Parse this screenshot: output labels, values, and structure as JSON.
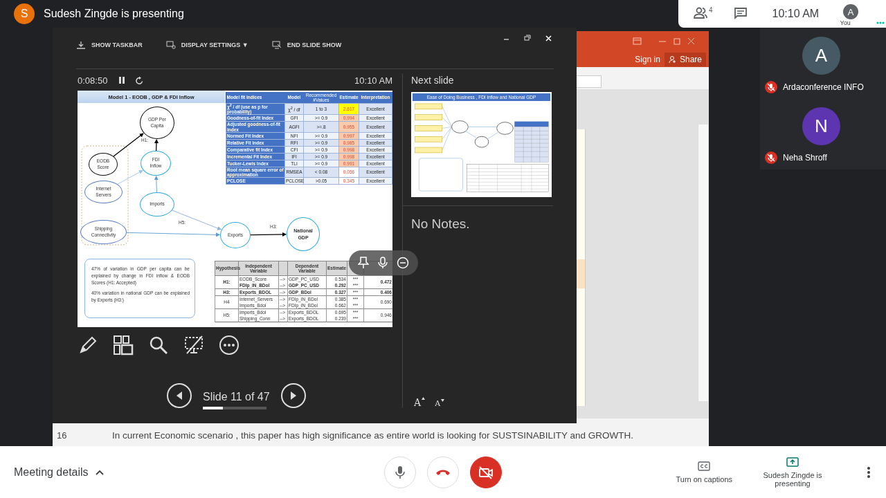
{
  "header": {
    "presenter_initial": "S",
    "title": "Sudesh Zingde is presenting",
    "people_count": "4",
    "time": "10:10 AM",
    "self_initial": "A",
    "self_label": "You"
  },
  "powerpoint": {
    "sign_in": "Sign in",
    "share": "Share",
    "notes_slide_number": "16",
    "notes_text": "In current Economic scenario , this paper has high significance as entire world is looking for SUSTSINABILITY and GROWTH."
  },
  "presenter": {
    "toolbar": [
      {
        "kind": "taskbar",
        "label": "SHOW TASKBAR"
      },
      {
        "kind": "display",
        "label": "DISPLAY SETTINGS ▼"
      },
      {
        "kind": "end",
        "label": "END SLIDE SHOW"
      }
    ],
    "timer": "0:08:50",
    "clock": "10:10 AM",
    "next_slide_label": "Next slide",
    "next_slide_title": "Ease of Doing Business , FDI inflow and National GDP",
    "notes": "No Notes.",
    "font_buttons": [
      {
        "kind": "grow",
        "label": "A"
      },
      {
        "kind": "shrink",
        "label": "A"
      }
    ],
    "slide_counter": "Slide 11 of 47",
    "progress": {
      "level": 0.32
    }
  },
  "slide": {
    "title": "Model 1 - EODB , GDP & FDI Inflow",
    "nodes": [
      {
        "label": "GDP Per Capita",
        "kind": "outcome"
      },
      {
        "label": "EODB Score",
        "kind": "outcome"
      },
      {
        "label": "FDI Inflow",
        "kind": "mediator"
      },
      {
        "label": "Internet Servers",
        "kind": "input"
      },
      {
        "label": "Imports",
        "kind": "mediator"
      },
      {
        "label": "Shipping Connectivity",
        "kind": "input"
      },
      {
        "label": "Exports",
        "kind": "mediator"
      },
      {
        "label": "National GDP",
        "kind": "final"
      }
    ],
    "path_labels": [
      "H1:",
      "H5:",
      "H3:"
    ],
    "callout": [
      "47% of variation in GDP per capita can be explained by change in FDI inflow & EODB Scores (H1: Accepted)",
      "40% variation in national GDP can be explained by Exports (H3:)"
    ],
    "fit_table": {
      "columns": [
        "Model fit indices",
        "Model",
        "Recommended #Values",
        "Estimate",
        "Interpretation"
      ],
      "rows": [
        {
          "index": "χ$^{2}$ / df (use as p for probability)",
          "model": "χ$^{2}$ / df",
          "recommended": "1 to 3",
          "estimate": "2.617",
          "color": "#ffff00",
          "interpretation": "Excellent"
        },
        {
          "index": "Goodness-of-fit Index",
          "model": "GFI",
          "recommended": ">= 0.9",
          "estimate": "0.994",
          "color": "#f8cbad",
          "interpretation": "Excellent"
        },
        {
          "index": "Adjusted goodness-of-fit index",
          "model": "AGFI",
          "recommended": ">=.8",
          "estimate": "0.955",
          "color": "#f8cbad",
          "interpretation": "Excellent"
        },
        {
          "index": "Normed Fit Index",
          "model": "NFI",
          "recommended": ">= 0.9",
          "estimate": "0.997",
          "color": "#f8cbad",
          "interpretation": "Excellent"
        },
        {
          "index": "Relative Fit Index",
          "model": "RFI",
          "recommended": ">= 0.9",
          "estimate": "0.985",
          "color": "#f8cbad",
          "interpretation": "Excellent"
        },
        {
          "index": "Comparative fit Index",
          "model": "CFI",
          "recommended": ">= 0.9",
          "estimate": "0.998",
          "color": "#f8cbad",
          "interpretation": "Excellent"
        },
        {
          "index": "Incremental Fit Index",
          "model": "IFI",
          "recommended": ">= 0.9",
          "estimate": "0.998",
          "color": "#f8cbad",
          "interpretation": "Excellent"
        },
        {
          "index": "Tucker-Lewis Index",
          "model": "TLI",
          "recommended": ">= 0.9",
          "estimate": "0.991",
          "color": "#f8cbad",
          "interpretation": "Excellent"
        },
        {
          "index": "Root mean square error of approximation",
          "model": "RMSEA",
          "recommended": "< 0.08",
          "estimate": "0.056",
          "color": "#ffffff",
          "interpretation": "Excellent"
        },
        {
          "index": "PCLOSE",
          "model": "PCLOSE",
          "recommended": ">0.05",
          "estimate": "0.345",
          "color": "#ffffff",
          "interpretation": "Excellent"
        }
      ]
    },
    "hypothesis_table": {
      "columns": [
        "Hypothesis",
        "Independent Variable",
        "Dependent Variable",
        "Estimate"
      ],
      "groups": [
        {
          "hypothesis": "H1:",
          "r_square": "0.472",
          "bold": true,
          "rows": [
            {
              "independent": "EODB_Score",
              "arrow": "-->",
              "dependent": "GDP_PC_USD",
              "estimate": "0.534",
              "p": "***",
              "bold": false
            },
            {
              "independent": "FDIp_IN_BDol",
              "arrow": "-->",
              "dependent": "GDP_PC_USD",
              "estimate": "0.292",
              "p": "***",
              "bold": true
            }
          ]
        },
        {
          "hypothesis": "H3:",
          "r_square": "0.406",
          "bold": true,
          "rows": [
            {
              "independent": "Exports_BDOL",
              "arrow": "-->",
              "dependent": "GDP_BDol",
              "estimate": "0.327",
              "p": "***",
              "bold": true
            }
          ]
        },
        {
          "hypothesis": "H4",
          "r_square": "0.690",
          "bold": false,
          "rows": [
            {
              "independent": "Internet_Servers",
              "arrow": "-->",
              "dependent": "FDIp_IN_BDol",
              "estimate": "0.385",
              "p": "***",
              "bold": false
            },
            {
              "independent": "Imports_Bdol",
              "arrow": "-->",
              "dependent": "FDIp_IN_BDol",
              "estimate": "0.662",
              "p": "***",
              "bold": false
            }
          ]
        },
        {
          "hypothesis": "H5:",
          "r_square": "0.946",
          "bold": false,
          "rows": [
            {
              "independent": "Imports_Bdol",
              "arrow": "-->",
              "dependent": "Exports_BDOL",
              "estimate": "0.695",
              "p": "***",
              "bold": false
            },
            {
              "independent": "Shipping_Conn",
              "arrow": "-->",
              "dependent": "Exports_BDOL",
              "estimate": "0.239",
              "p": "***",
              "bold": false
            }
          ]
        }
      ]
    }
  },
  "participants": [
    {
      "initial": "A",
      "name": "Ardaconference INFO",
      "color": "#455a64",
      "muted": true
    },
    {
      "initial": "N",
      "name": "Neha Shroff",
      "color": "#5e35b1",
      "muted": true
    }
  ],
  "controls": {
    "meeting_details": "Meeting details",
    "mic_on": true,
    "camera_on": false,
    "captions": "Turn on captions",
    "presenting": "Sudesh Zingde is presenting"
  }
}
